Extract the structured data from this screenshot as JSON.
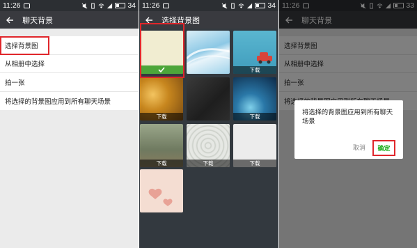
{
  "status": {
    "time": "11:26",
    "battery": [
      "34",
      "34",
      "33"
    ]
  },
  "panel1": {
    "title": "聊天背景",
    "items": [
      "选择背景图",
      "从相册中选择",
      "拍一张",
      "将选择的背景图应用到所有聊天场景"
    ]
  },
  "panel2": {
    "title": "选择背景图",
    "download_label": "下载",
    "tiles": [
      {
        "name": "cream",
        "selected": true,
        "download": false
      },
      {
        "name": "blue-wave",
        "selected": false,
        "download": false
      },
      {
        "name": "red-car",
        "selected": false,
        "download": true
      },
      {
        "name": "bokeh-orange",
        "selected": false,
        "download": true
      },
      {
        "name": "dark-texture",
        "selected": false,
        "download": false
      },
      {
        "name": "blue-bokeh",
        "selected": false,
        "download": true
      },
      {
        "name": "rainy-window",
        "selected": false,
        "download": true
      },
      {
        "name": "lace-pattern",
        "selected": false,
        "download": true
      },
      {
        "name": "white-paper",
        "selected": false,
        "download": true
      },
      {
        "name": "pink-hearts",
        "selected": false,
        "download": false
      }
    ]
  },
  "panel3": {
    "title": "聊天背景",
    "items": [
      "选择背景图",
      "从相册中选择",
      "拍一张",
      "将选择的背景图应用到所有聊天场景"
    ],
    "dialog": {
      "message": "将选择的背景图应用到所有聊天场景",
      "cancel": "取消",
      "ok": "确定"
    }
  },
  "colors": {
    "accent_green": "#4da63a",
    "highlight_red": "#e0262b",
    "titlebar": "#393a3f"
  }
}
